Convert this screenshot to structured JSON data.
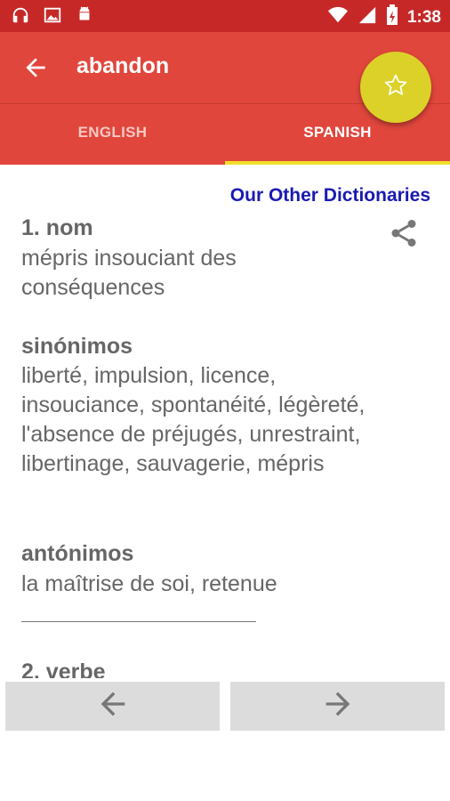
{
  "status_bar": {
    "time": "1:38",
    "left_icons": [
      "headphones-icon",
      "image-icon",
      "android-icon"
    ],
    "right_icons": [
      "wifi-icon",
      "signal-icon",
      "battery-icon"
    ]
  },
  "app_bar": {
    "title": "abandon",
    "back_icon": "arrow-left-icon",
    "fab_icon": "star-outline-icon"
  },
  "tabs": [
    {
      "label": "ENGLISH",
      "selected": false
    },
    {
      "label": "SPANISH",
      "selected": true
    }
  ],
  "content": {
    "other_dictionaries": "Our Other Dictionaries",
    "share_icon": "share-icon",
    "entry1_heading": "1. nom",
    "entry1_definition": "mépris insouciant des conséquences",
    "synonyms_heading": "sinónimos",
    "synonyms_text": "liberté, impulsion, licence, insouciance, spontanéité, légèreté, l'absence de préjugés, unrestraint, libertinage, sauvagerie, mépris",
    "antonyms_heading": "antónimos",
    "antonyms_text": "la maîtrise de soi, retenue",
    "entry2_heading": "2. verbe"
  },
  "bottom_nav": {
    "prev_icon": "arrow-left-icon",
    "next_icon": "arrow-right-icon"
  },
  "colors": {
    "status_bar": "#c62828",
    "app_bar": "#e0463c",
    "tab_indicator": "#f0de2b",
    "fab": "#dcd128",
    "link": "#1a1ab0",
    "nav_button": "#dcdcdc"
  }
}
